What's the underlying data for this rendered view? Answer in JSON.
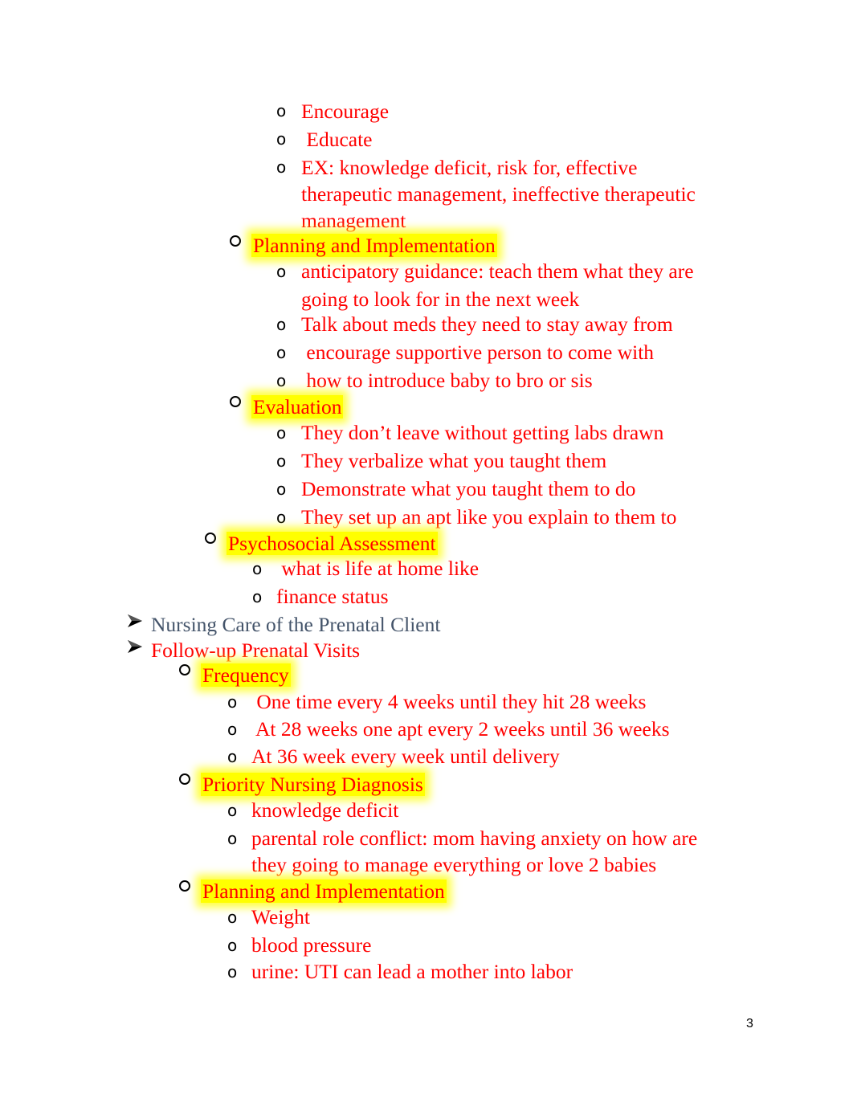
{
  "page_number": "3",
  "colors": {
    "text_red": "#ff0000",
    "heading_slate": "#44546a",
    "highlight": "#ffff00"
  },
  "outline": {
    "top_items": [
      "Encourage",
      " Educate",
      "EX: knowledge deficit, risk for, effective",
      "therapeutic management, ineffective therapeutic",
      "management"
    ],
    "planning1": {
      "heading": "Planning and Implementation",
      "items": [
        "anticipatory guidance: teach them what they are",
        "going to look for in the next week",
        "Talk about meds they need to stay away from",
        " encourage supportive person to come with",
        " how to introduce baby to bro or sis"
      ]
    },
    "evaluation": {
      "heading": "Evaluation",
      "items": [
        "They don’t leave without getting labs drawn",
        "They verbalize what you taught them",
        "Demonstrate what you taught them to do",
        "They set up an apt like you explain to them to"
      ]
    },
    "psychosocial": {
      "heading": "Psychosocial Assessment",
      "items": [
        " what is life at home like",
        "finance status"
      ]
    },
    "section1": "Nursing Care of the Prenatal Client",
    "section2": "Follow-up Prenatal Visits",
    "frequency": {
      "heading": "Frequency",
      "items": [
        " One time every 4 weeks until they hit 28 weeks",
        " At 28 weeks one apt every 2 weeks until 36 weeks",
        "At 36 week every week until delivery"
      ]
    },
    "priority": {
      "heading": "Priority Nursing Diagnosis",
      "items": [
        "knowledge deficit",
        "parental role conflict: mom having anxiety on how are",
        "they going to manage everything or love 2 babies"
      ]
    },
    "planning2": {
      "heading": "Planning and Implementation",
      "items": [
        "Weight",
        "blood pressure",
        "urine: UTI can lead a mother into labor"
      ]
    }
  }
}
